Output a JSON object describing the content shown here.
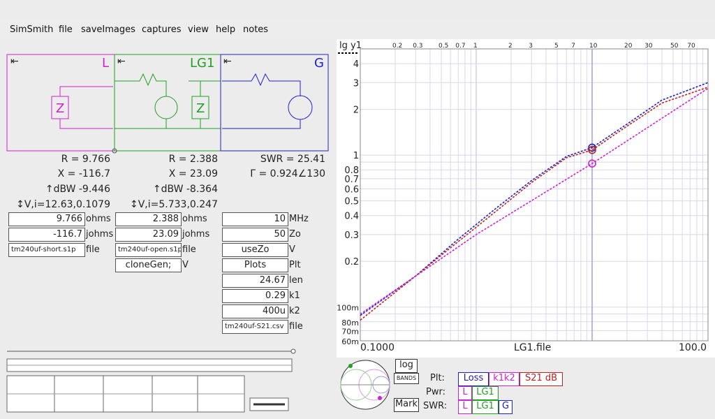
{
  "menu": [
    "SimSmith",
    "file",
    "saveImages",
    "captures",
    "view",
    "help",
    "notes"
  ],
  "blocks": {
    "L": {
      "name": "L",
      "color": "#d020d0",
      "arrow": "⇤",
      "R": "R = 9.766",
      "X": "X = -116.7",
      "dBW": "↑dBW -9.446",
      "Vi": "↕V,i=12.63,0.1079",
      "fields": [
        {
          "value": "9.766",
          "unit": "ohms"
        },
        {
          "value": "-116.7",
          "unit": "johms"
        },
        {
          "value": "tm240uf-short.s1p",
          "unit": "file"
        }
      ]
    },
    "LG1": {
      "name": "LG1",
      "color": "#20a020",
      "arrow": "⇤",
      "R": "R = 2.388",
      "X": "X = 23.09",
      "dBW": "↑dBW -8.364",
      "Vi": "↕V,i=5.733,0.247",
      "fields": [
        {
          "value": "2.388",
          "unit": "ohms"
        },
        {
          "value": "23.09",
          "unit": "johms"
        },
        {
          "value": "tm240uf-open.s1p",
          "unit": "file"
        },
        {
          "value": "cloneGen;",
          "unit": "V"
        }
      ]
    },
    "G": {
      "name": "G",
      "color": "#2020d0",
      "arrow": "⇤",
      "SWR": "SWR = 25.41",
      "Gamma": "Γ = 0.924∠130",
      "fields": [
        {
          "value": "10",
          "unit": "MHz"
        },
        {
          "value": "50",
          "unit": "Zo"
        },
        {
          "value": "useZo",
          "unit": "V"
        },
        {
          "value": "Plots",
          "unit": "Plt"
        },
        {
          "value": "24.67",
          "unit": "len"
        },
        {
          "value": "0.29",
          "unit": "k1"
        },
        {
          "value": "400u",
          "unit": "k2"
        },
        {
          "value": "tm240uf-S21.csv",
          "unit": "file"
        }
      ]
    }
  },
  "graph": {
    "ylabel": "lg y1",
    "xlabel": "LG1.file",
    "x_left": "0.1000",
    "x_right": "100.0",
    "top_ticks": [
      "0.2",
      "0.3",
      "0.5",
      "0.7",
      "1",
      "2",
      "3",
      "5",
      "7",
      "10",
      "20",
      "30",
      "50",
      "70"
    ],
    "y_ticks": [
      "4",
      "3",
      "2",
      "1",
      "0.8",
      "0.7",
      "0.6",
      "0.5",
      "0.4",
      "0.3",
      "0.2",
      "100m",
      "80m",
      "70m",
      "60m"
    ]
  },
  "chart_data": {
    "type": "line",
    "x_scale": "log",
    "y_scale": "log",
    "xlim": [
      0.1,
      100
    ],
    "ylim": [
      0.06,
      5
    ],
    "xlabel": "LG1.file",
    "ylabel": "lg y1",
    "marker_x": 10,
    "series": [
      {
        "color": "#2020c0",
        "x": [
          0.1,
          0.3,
          0.7,
          1.5,
          3,
          6,
          10,
          20,
          40,
          100
        ],
        "values": [
          0.088,
          0.16,
          0.28,
          0.45,
          0.68,
          0.98,
          1.12,
          1.6,
          2.3,
          3.0
        ]
      },
      {
        "color": "#c02020",
        "x": [
          0.1,
          0.3,
          0.7,
          1.5,
          3,
          6,
          10,
          20,
          40,
          100
        ],
        "values": [
          0.082,
          0.16,
          0.27,
          0.43,
          0.66,
          0.96,
          1.08,
          1.55,
          2.2,
          2.8
        ]
      },
      {
        "color": "#d020d0",
        "x": [
          0.1,
          1,
          10,
          100
        ],
        "values": [
          0.09,
          0.3,
          0.88,
          2.75
        ]
      }
    ]
  },
  "buttons": {
    "log": "log",
    "bands": "BANDS",
    "mark": "Mark"
  },
  "plt": {
    "label": "Plt:",
    "items": [
      {
        "text": "Loss",
        "color": "#2020c0"
      },
      {
        "text": "k1k2",
        "color": "#d020d0"
      },
      {
        "text": "S21 dB",
        "color": "#c02020"
      }
    ]
  },
  "pwr": {
    "label": "Pwr:",
    "items": [
      "L",
      "LG1"
    ]
  },
  "swr": {
    "label": "SWR:",
    "items": [
      "L",
      "LG1",
      "G"
    ]
  }
}
